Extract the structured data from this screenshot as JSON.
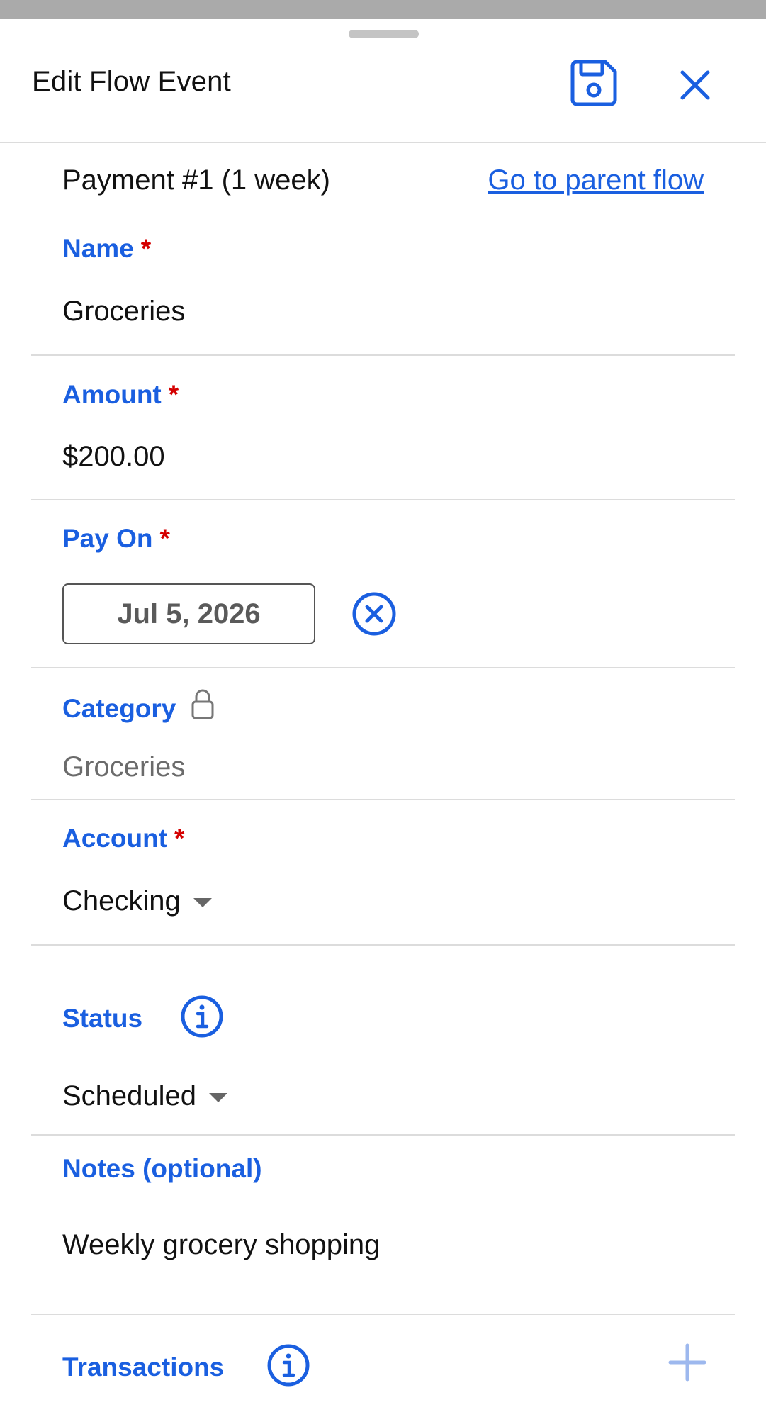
{
  "header": {
    "title": "Edit Flow Event",
    "save_icon": "save-icon",
    "close_icon": "close-icon"
  },
  "subheader": {
    "payment_label": "Payment #1 (1 week)",
    "parent_link": "Go to parent flow"
  },
  "fields": {
    "name": {
      "label": "Name",
      "required_mark": "*",
      "value": "Groceries"
    },
    "amount": {
      "label": "Amount",
      "required_mark": "*",
      "value": "$200.00"
    },
    "pay_on": {
      "label": "Pay On",
      "required_mark": "*",
      "value": "Jul 5, 2026"
    },
    "category": {
      "label": "Category",
      "value": "Groceries",
      "locked": true
    },
    "account": {
      "label": "Account",
      "required_mark": "*",
      "value": "Checking"
    },
    "status": {
      "label": "Status",
      "value": "Scheduled"
    },
    "notes": {
      "label": "Notes (optional)",
      "value": "Weekly grocery shopping"
    },
    "transactions": {
      "label": "Transactions"
    }
  },
  "colors": {
    "accent": "#1a5fe0",
    "required": "#d40000",
    "divider": "#dcdcdc",
    "plus": "#9db8ee"
  }
}
